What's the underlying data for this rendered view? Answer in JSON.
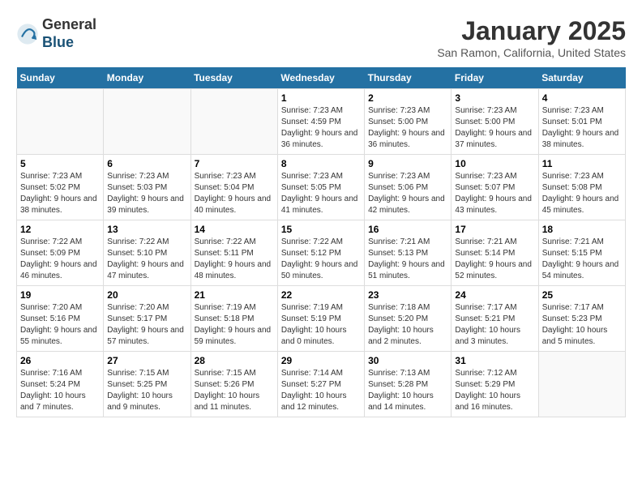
{
  "header": {
    "logo_line1": "General",
    "logo_line2": "Blue",
    "month_title": "January 2025",
    "location": "San Ramon, California, United States"
  },
  "days_of_week": [
    "Sunday",
    "Monday",
    "Tuesday",
    "Wednesday",
    "Thursday",
    "Friday",
    "Saturday"
  ],
  "weeks": [
    [
      {
        "num": "",
        "info": ""
      },
      {
        "num": "",
        "info": ""
      },
      {
        "num": "",
        "info": ""
      },
      {
        "num": "1",
        "info": "Sunrise: 7:23 AM\nSunset: 4:59 PM\nDaylight: 9 hours and 36 minutes."
      },
      {
        "num": "2",
        "info": "Sunrise: 7:23 AM\nSunset: 5:00 PM\nDaylight: 9 hours and 36 minutes."
      },
      {
        "num": "3",
        "info": "Sunrise: 7:23 AM\nSunset: 5:00 PM\nDaylight: 9 hours and 37 minutes."
      },
      {
        "num": "4",
        "info": "Sunrise: 7:23 AM\nSunset: 5:01 PM\nDaylight: 9 hours and 38 minutes."
      }
    ],
    [
      {
        "num": "5",
        "info": "Sunrise: 7:23 AM\nSunset: 5:02 PM\nDaylight: 9 hours and 38 minutes."
      },
      {
        "num": "6",
        "info": "Sunrise: 7:23 AM\nSunset: 5:03 PM\nDaylight: 9 hours and 39 minutes."
      },
      {
        "num": "7",
        "info": "Sunrise: 7:23 AM\nSunset: 5:04 PM\nDaylight: 9 hours and 40 minutes."
      },
      {
        "num": "8",
        "info": "Sunrise: 7:23 AM\nSunset: 5:05 PM\nDaylight: 9 hours and 41 minutes."
      },
      {
        "num": "9",
        "info": "Sunrise: 7:23 AM\nSunset: 5:06 PM\nDaylight: 9 hours and 42 minutes."
      },
      {
        "num": "10",
        "info": "Sunrise: 7:23 AM\nSunset: 5:07 PM\nDaylight: 9 hours and 43 minutes."
      },
      {
        "num": "11",
        "info": "Sunrise: 7:23 AM\nSunset: 5:08 PM\nDaylight: 9 hours and 45 minutes."
      }
    ],
    [
      {
        "num": "12",
        "info": "Sunrise: 7:22 AM\nSunset: 5:09 PM\nDaylight: 9 hours and 46 minutes."
      },
      {
        "num": "13",
        "info": "Sunrise: 7:22 AM\nSunset: 5:10 PM\nDaylight: 9 hours and 47 minutes."
      },
      {
        "num": "14",
        "info": "Sunrise: 7:22 AM\nSunset: 5:11 PM\nDaylight: 9 hours and 48 minutes."
      },
      {
        "num": "15",
        "info": "Sunrise: 7:22 AM\nSunset: 5:12 PM\nDaylight: 9 hours and 50 minutes."
      },
      {
        "num": "16",
        "info": "Sunrise: 7:21 AM\nSunset: 5:13 PM\nDaylight: 9 hours and 51 minutes."
      },
      {
        "num": "17",
        "info": "Sunrise: 7:21 AM\nSunset: 5:14 PM\nDaylight: 9 hours and 52 minutes."
      },
      {
        "num": "18",
        "info": "Sunrise: 7:21 AM\nSunset: 5:15 PM\nDaylight: 9 hours and 54 minutes."
      }
    ],
    [
      {
        "num": "19",
        "info": "Sunrise: 7:20 AM\nSunset: 5:16 PM\nDaylight: 9 hours and 55 minutes."
      },
      {
        "num": "20",
        "info": "Sunrise: 7:20 AM\nSunset: 5:17 PM\nDaylight: 9 hours and 57 minutes."
      },
      {
        "num": "21",
        "info": "Sunrise: 7:19 AM\nSunset: 5:18 PM\nDaylight: 9 hours and 59 minutes."
      },
      {
        "num": "22",
        "info": "Sunrise: 7:19 AM\nSunset: 5:19 PM\nDaylight: 10 hours and 0 minutes."
      },
      {
        "num": "23",
        "info": "Sunrise: 7:18 AM\nSunset: 5:20 PM\nDaylight: 10 hours and 2 minutes."
      },
      {
        "num": "24",
        "info": "Sunrise: 7:17 AM\nSunset: 5:21 PM\nDaylight: 10 hours and 3 minutes."
      },
      {
        "num": "25",
        "info": "Sunrise: 7:17 AM\nSunset: 5:23 PM\nDaylight: 10 hours and 5 minutes."
      }
    ],
    [
      {
        "num": "26",
        "info": "Sunrise: 7:16 AM\nSunset: 5:24 PM\nDaylight: 10 hours and 7 minutes."
      },
      {
        "num": "27",
        "info": "Sunrise: 7:15 AM\nSunset: 5:25 PM\nDaylight: 10 hours and 9 minutes."
      },
      {
        "num": "28",
        "info": "Sunrise: 7:15 AM\nSunset: 5:26 PM\nDaylight: 10 hours and 11 minutes."
      },
      {
        "num": "29",
        "info": "Sunrise: 7:14 AM\nSunset: 5:27 PM\nDaylight: 10 hours and 12 minutes."
      },
      {
        "num": "30",
        "info": "Sunrise: 7:13 AM\nSunset: 5:28 PM\nDaylight: 10 hours and 14 minutes."
      },
      {
        "num": "31",
        "info": "Sunrise: 7:12 AM\nSunset: 5:29 PM\nDaylight: 10 hours and 16 minutes."
      },
      {
        "num": "",
        "info": ""
      }
    ]
  ]
}
